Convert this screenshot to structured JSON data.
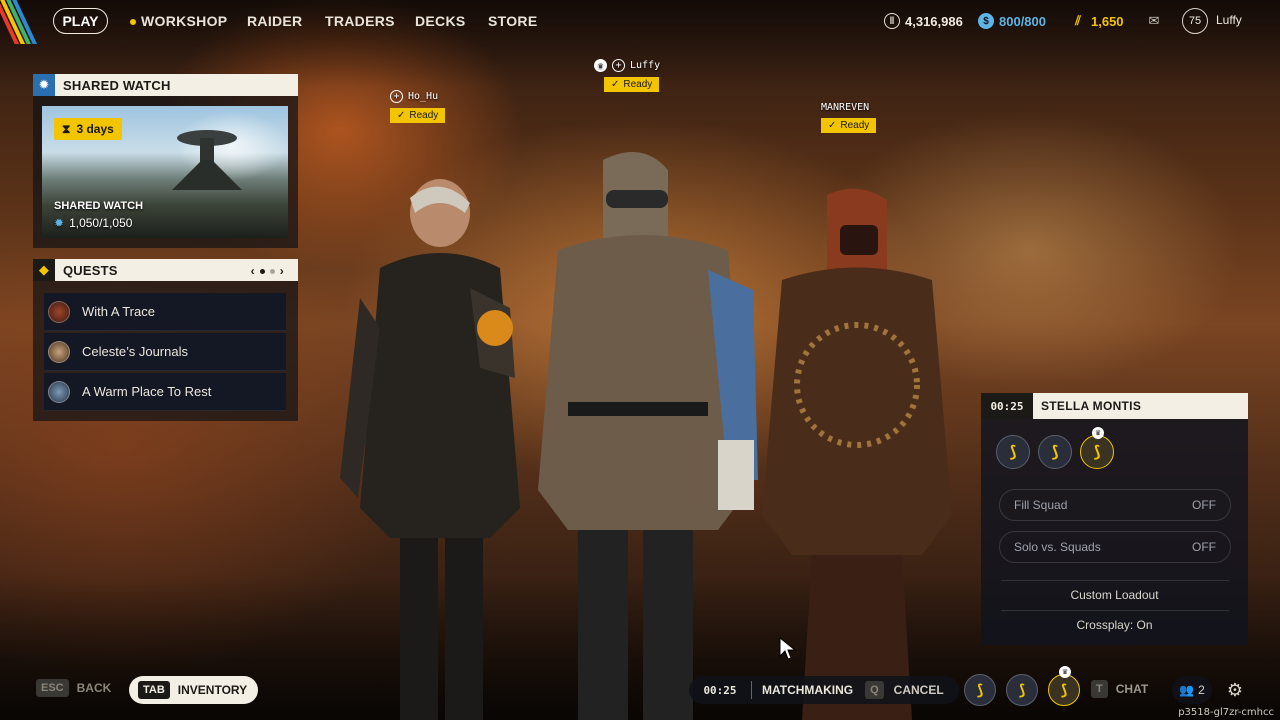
{
  "topbar": {
    "play_label": "PLAY",
    "nav": [
      "WORKSHOP",
      "RAIDER",
      "TRADERS",
      "DECKS",
      "STORE"
    ],
    "currencies": [
      {
        "icon": "coins-icon",
        "value": "4,316,986"
      },
      {
        "icon": "raider-token-icon",
        "value": "800/800"
      },
      {
        "icon": "premium-currency-icon",
        "value": "1,650"
      }
    ],
    "level": "75",
    "username": "Luffy"
  },
  "shared_watch": {
    "header": "SHARED WATCH",
    "days": "3  days",
    "title": "SHARED WATCH",
    "progress": "1,050/1,050"
  },
  "quests": {
    "header": "QUESTS",
    "items": [
      "With A Trace",
      "Celeste’s Journals",
      "A Warm Place To Rest"
    ]
  },
  "players": [
    {
      "name": "Ho_Hu",
      "status": "Ready"
    },
    {
      "name": "Luffy",
      "status": "Ready"
    },
    {
      "name": "MANREVEN",
      "status": "Ready"
    }
  ],
  "matchmaking": {
    "timer": "00:25",
    "map": "STELLA MONTIS",
    "options": [
      {
        "label": "Fill Squad",
        "value": "OFF"
      },
      {
        "label": "Solo vs. Squads",
        "value": "OFF"
      }
    ],
    "custom_loadout": "Custom Loadout",
    "crossplay": "Crossplay: On"
  },
  "bottombar": {
    "back_key": "ESC",
    "back_label": "BACK",
    "inventory_key": "TAB",
    "inventory_label": "INVENTORY",
    "timer": "00:25",
    "matchmaking_label": "MATCHMAKING",
    "cancel_key": "Q",
    "cancel_label": "CANCEL",
    "chat_key": "T",
    "chat_label": "CHAT",
    "friends_count": "2"
  },
  "build_id": "p3518-gl7zr-cmhcc",
  "colors": {
    "accent": "#f3c400",
    "panel_light": "#f4efe4",
    "panel_dark": "#10141e",
    "shared_watch_icon": "#2a6fb0"
  }
}
